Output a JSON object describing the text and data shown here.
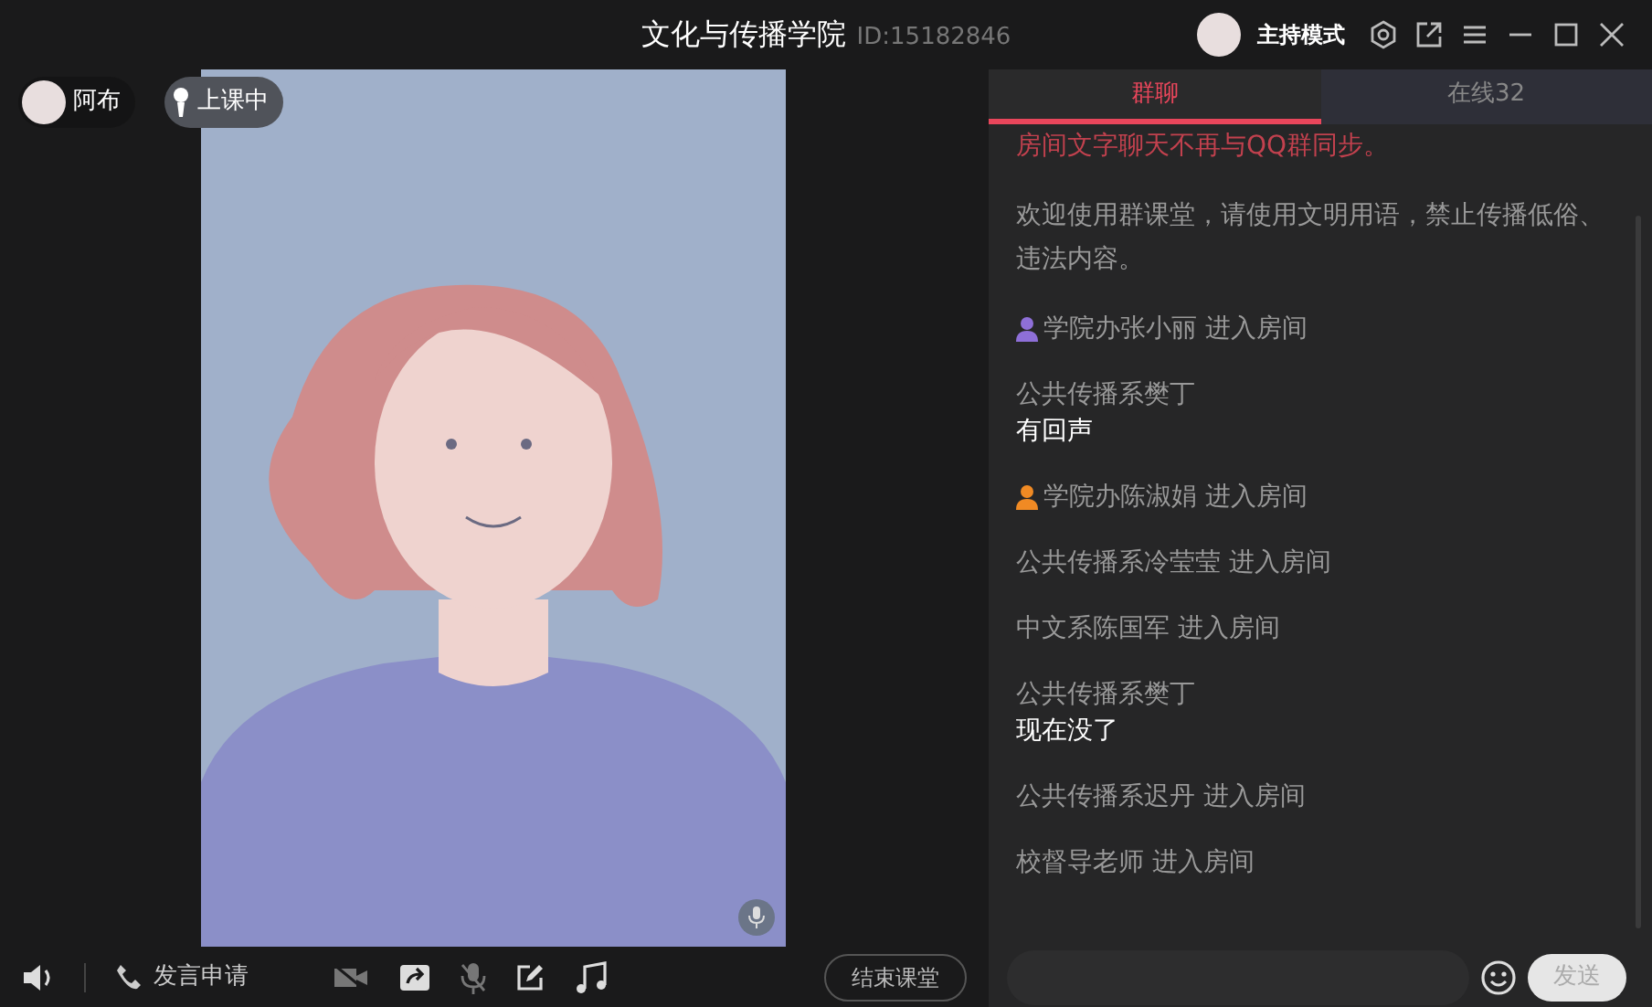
{
  "window": {
    "title": "文化与传播学院",
    "room_id": "ID:15182846",
    "mode": "主持模式"
  },
  "stage": {
    "user": "阿布",
    "status": "上课中"
  },
  "toolbar": {
    "request": "发言申请",
    "end_button": "结束课堂"
  },
  "tabs": [
    {
      "label": "群聊",
      "selected": true
    },
    {
      "label": "在线32",
      "selected": false
    }
  ],
  "messages": [
    {
      "kind": "alert",
      "text": "房间文字聊天不再与QQ群同步。"
    },
    {
      "kind": "system",
      "text": "欢迎使用群课堂，请使用文明用语，禁止传播低俗、违法内容。"
    },
    {
      "kind": "join",
      "name": "学院办张小丽",
      "action": "进入房间",
      "color": "#8e6fd8"
    },
    {
      "kind": "chat",
      "sender": "公共传播系樊丁",
      "text": "有回声"
    },
    {
      "kind": "join",
      "name": "学院办陈淑娟",
      "action": "进入房间",
      "color": "#f08a24"
    },
    {
      "kind": "join",
      "name": "公共传播系冷莹莹",
      "action": "进入房间"
    },
    {
      "kind": "join",
      "name": "中文系陈国军",
      "action": "进入房间"
    },
    {
      "kind": "chat",
      "sender": "公共传播系樊丁",
      "text": "现在没了"
    },
    {
      "kind": "join",
      "name": "公共传播系迟丹",
      "action": "进入房间"
    },
    {
      "kind": "join",
      "name": "校督导老师",
      "action": "进入房间"
    }
  ],
  "composer": {
    "send": "发送"
  }
}
